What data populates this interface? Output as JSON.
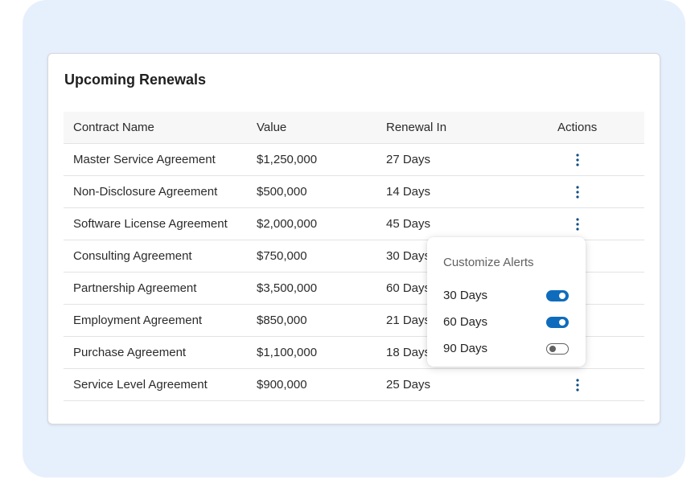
{
  "card": {
    "title": "Upcoming Renewals"
  },
  "table": {
    "columns": [
      "Contract Name",
      "Value",
      "Renewal In",
      "Actions"
    ],
    "rows": [
      {
        "name": "Master Service Agreement",
        "value": "$1,250,000",
        "renewal": "27 Days"
      },
      {
        "name": "Non-Disclosure Agreement",
        "value": "$500,000",
        "renewal": "14 Days"
      },
      {
        "name": "Software License Agreement",
        "value": "$2,000,000",
        "renewal": "45 Days"
      },
      {
        "name": "Consulting Agreement",
        "value": "$750,000",
        "renewal": "30 Days"
      },
      {
        "name": "Partnership Agreement",
        "value": "$3,500,000",
        "renewal": "60 Days"
      },
      {
        "name": "Employment Agreement",
        "value": "$850,000",
        "renewal": "21 Days"
      },
      {
        "name": "Purchase Agreement",
        "value": "$1,100,000",
        "renewal": "18 Days"
      },
      {
        "name": "Service Level Agreement",
        "value": "$900,000",
        "renewal": "25 Days"
      }
    ],
    "row_action_icon": "more-vertical-icon"
  },
  "alerts_popover": {
    "title": "Customize Alerts",
    "options": [
      {
        "label": "30 Days",
        "enabled": true
      },
      {
        "label": "60 Days",
        "enabled": true
      },
      {
        "label": "90 Days",
        "enabled": false
      }
    ]
  },
  "colors": {
    "background_panel": "#e6f0fd",
    "toggle_on": "#0f6cbd",
    "toggle_off_border": "#616161",
    "action_icon": "#0f4c81"
  }
}
